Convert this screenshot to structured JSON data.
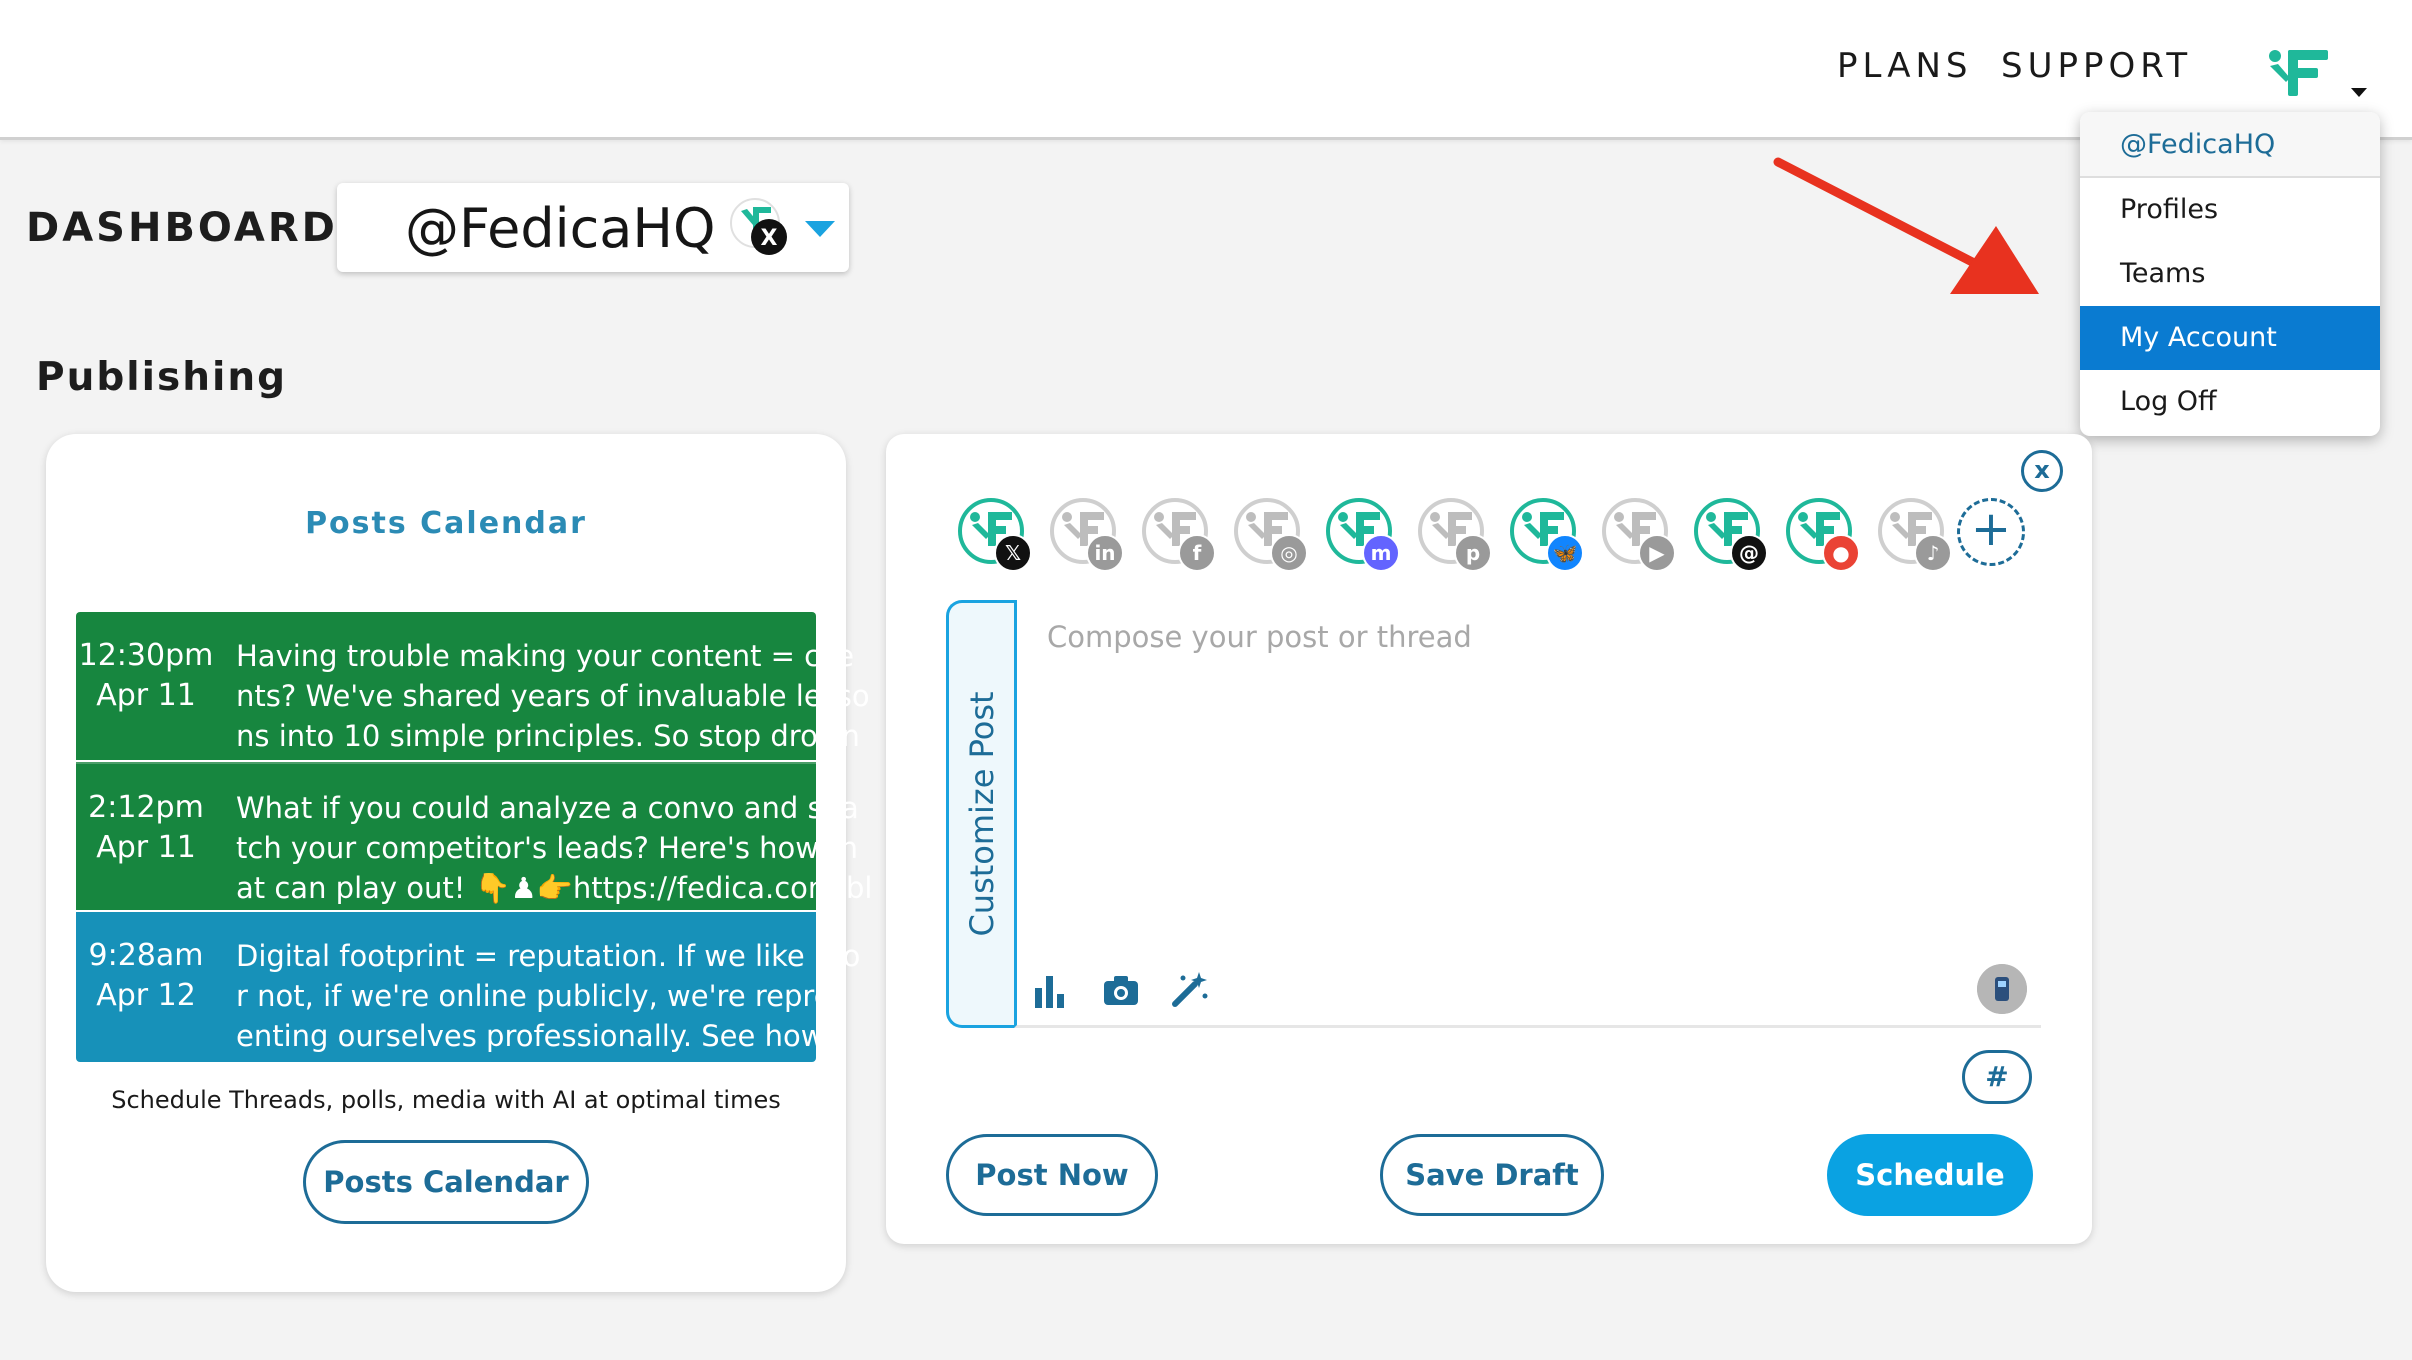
{
  "topbar": {
    "plans_label": "PLANS",
    "support_label": "SUPPORT"
  },
  "account_menu": {
    "header": "@FedicaHQ",
    "items": [
      {
        "label": "Profiles",
        "active": false
      },
      {
        "label": "Teams",
        "active": false
      },
      {
        "label": "My Account",
        "active": true
      },
      {
        "label": "Log Off",
        "active": false
      }
    ]
  },
  "dashboard": {
    "title": "DASHBOARD",
    "selected_account": "@FedicaHQ",
    "section_title": "Publishing"
  },
  "calendar_card": {
    "title": "Posts Calendar",
    "posts": [
      {
        "time": "12:30pm",
        "date": "Apr 11",
        "text": "Having trouble making your content = clie\nnts? We've shared years of invaluable lesso\nns into 10 simple principles. So stop drown",
        "color": "#17863f"
      },
      {
        "time": "2:12pm",
        "date": "Apr 11",
        "text": "What if you could analyze a convo and sna\ntch your competitor's leads? Here's how th\nat can play out! 👇♟👉https://fedica.com/bl",
        "color": "#17863f"
      },
      {
        "time": "9:28am",
        "date": "Apr 12",
        "text": "Digital footprint = reputation. If we like it o\nr not, if we're online publicly, we're repres\nenting ourselves professionally. See how t",
        "color": "#1791b9"
      }
    ],
    "subtext": "Schedule Threads, polls, media with AI at optimal times",
    "button_label": "Posts Calendar"
  },
  "compose_card": {
    "close_label": "x",
    "networks": [
      {
        "name": "x",
        "icon": "x-icon",
        "active": true,
        "color": "#111111",
        "glyph": "𝕏"
      },
      {
        "name": "linkedin",
        "icon": "linkedin-icon",
        "active": false,
        "color": "#9a9a9a",
        "glyph": "in"
      },
      {
        "name": "facebook",
        "icon": "facebook-icon",
        "active": false,
        "color": "#9a9a9a",
        "glyph": "f"
      },
      {
        "name": "instagram",
        "icon": "instagram-icon",
        "active": false,
        "color": "#9a9a9a",
        "glyph": "◎"
      },
      {
        "name": "mastodon",
        "icon": "mastodon-icon",
        "active": true,
        "color": "#6364ff",
        "glyph": "m"
      },
      {
        "name": "pinterest",
        "icon": "pinterest-icon",
        "active": false,
        "color": "#9a9a9a",
        "glyph": "p"
      },
      {
        "name": "bluesky",
        "icon": "bluesky-icon",
        "active": true,
        "color": "#1185fe",
        "glyph": "🦋"
      },
      {
        "name": "youtube",
        "icon": "youtube-icon",
        "active": false,
        "color": "#9a9a9a",
        "glyph": "▶"
      },
      {
        "name": "threads",
        "icon": "threads-icon",
        "active": true,
        "color": "#111111",
        "glyph": "@"
      },
      {
        "name": "google-business",
        "icon": "google-business-icon",
        "active": true,
        "color": "#ea4335",
        "glyph": "●"
      },
      {
        "name": "tiktok",
        "icon": "tiktok-icon",
        "active": false,
        "color": "#9a9a9a",
        "glyph": "♪"
      }
    ],
    "add_network_label": "+",
    "customize_label": "Customize Post",
    "compose_placeholder": "Compose your post or thread",
    "hashtag_label": "#",
    "post_now_label": "Post Now",
    "save_draft_label": "Save Draft",
    "schedule_label": "Schedule"
  },
  "colors": {
    "brand_teal": "#1fb89a",
    "accent_blue": "#0aa2e2",
    "menu_active": "#0a7bd1",
    "post_green": "#17863f",
    "post_blue": "#1791b9",
    "annotation_red": "#e8321f"
  }
}
